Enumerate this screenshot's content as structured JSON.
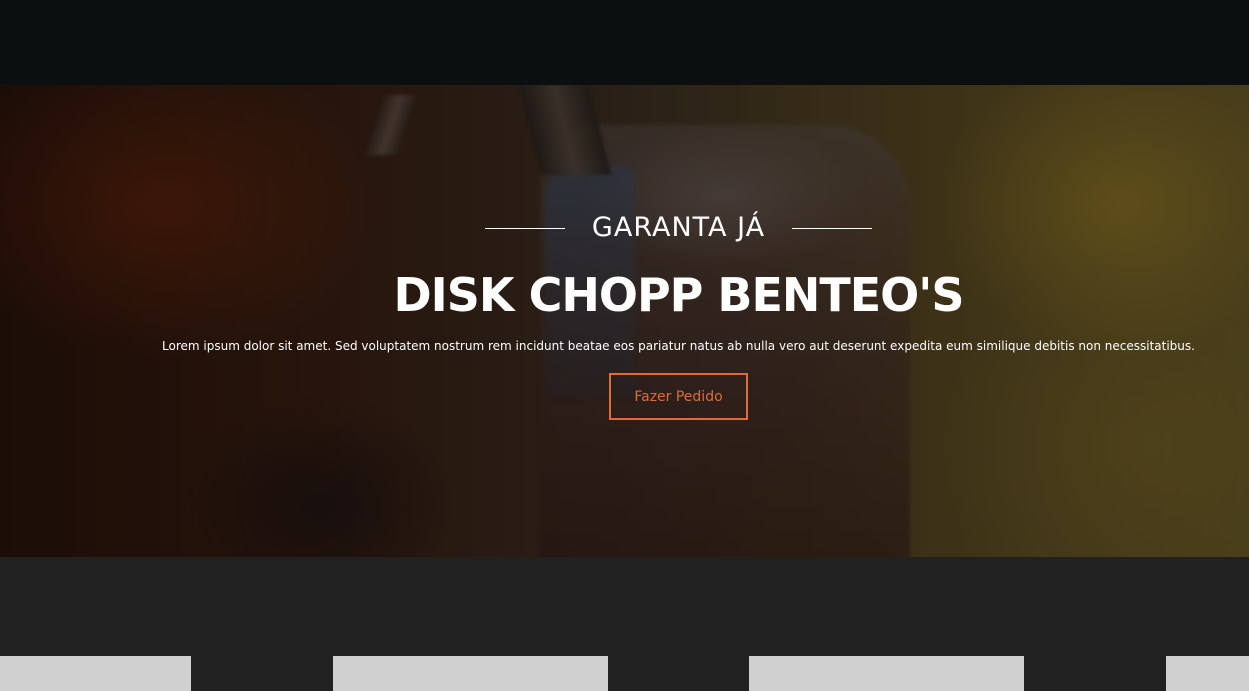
{
  "hero": {
    "eyebrow": "GARANTA JÁ",
    "title": "DISK CHOPP BENTEO'S",
    "description": "Lorem ipsum dolor sit amet. Sed voluptatem nostrum rem incidunt beatae eos pariatur natus ab nulla vero aut deserunt expedita eum similique debitis non necessitatibus.",
    "button_label": "Fazer Pedido"
  },
  "colors": {
    "accent": "#e06a3a",
    "topbar": "#0a0f10",
    "section_background": "#212121",
    "card": "#d0d0d0"
  }
}
